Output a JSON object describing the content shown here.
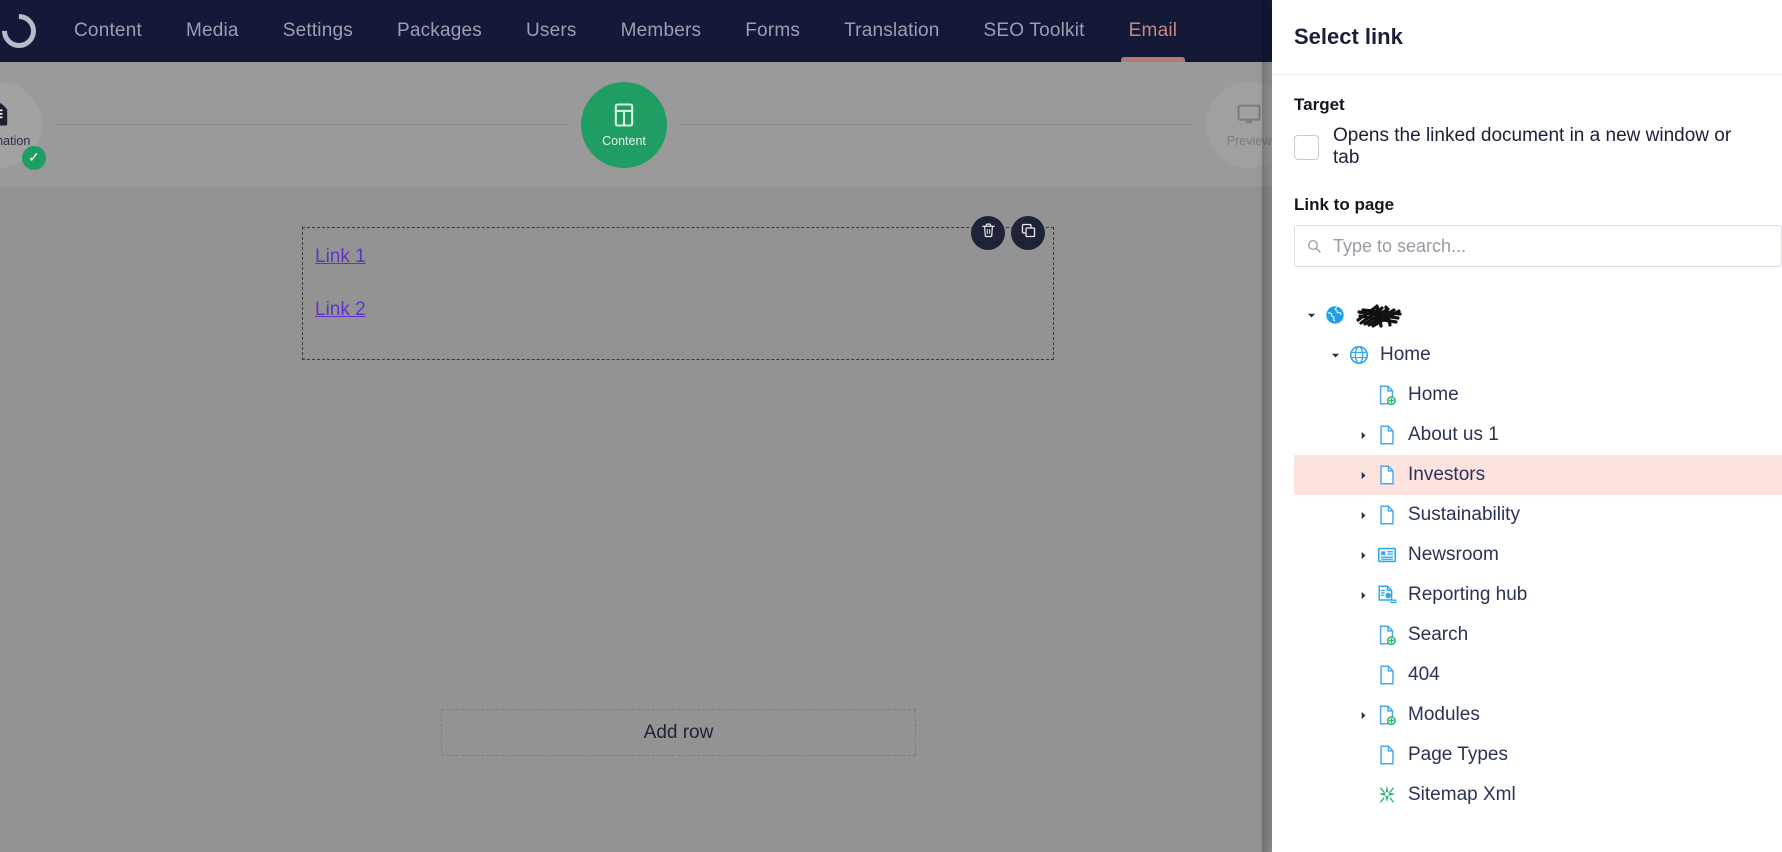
{
  "topnav": {
    "logo_name": "umbraco-logo",
    "items": [
      {
        "label": "Content",
        "active": false
      },
      {
        "label": "Media",
        "active": false
      },
      {
        "label": "Settings",
        "active": false
      },
      {
        "label": "Packages",
        "active": false
      },
      {
        "label": "Users",
        "active": false
      },
      {
        "label": "Members",
        "active": false
      },
      {
        "label": "Forms",
        "active": false
      },
      {
        "label": "Translation",
        "active": false
      },
      {
        "label": "SEO Toolkit",
        "active": false
      },
      {
        "label": "Email",
        "active": true
      }
    ],
    "bg_color": "#141938",
    "active_color": "#c7897f"
  },
  "stepper": {
    "steps": [
      {
        "label": "Information",
        "state": "complete",
        "icon": "document-icon",
        "check": "✓"
      },
      {
        "label": "Content",
        "state": "active",
        "icon": "layout-icon"
      },
      {
        "label": "Preview",
        "state": "muted",
        "icon": "monitor-icon"
      }
    ],
    "active_color": "#1f9d62"
  },
  "canvas": {
    "row_block": {
      "links": [
        "Link 1",
        "Link 2 "
      ],
      "link_color": "#6134c9",
      "actions": [
        {
          "name": "delete-row-button",
          "icon": "trash-icon"
        },
        {
          "name": "copy-row-button",
          "icon": "copy-icon"
        }
      ]
    },
    "add_row_label": "Add row"
  },
  "panel": {
    "title": "Select link",
    "target": {
      "label": "Target",
      "checkbox_label": "Opens the linked document in a new window or tab",
      "checked": false
    },
    "link_to_page": {
      "label": "Link to page",
      "search_placeholder": "Type to search...",
      "search_value": ""
    },
    "tree": {
      "highlight_color": "#fce3de",
      "nodes": [
        {
          "label": "",
          "redacted": true,
          "icon": "globe-icon",
          "depth": 0,
          "caret": "expanded",
          "highlight": false
        },
        {
          "label": "Home",
          "icon": "globe-outline-icon",
          "depth": 1,
          "caret": "expanded",
          "highlight": false
        },
        {
          "label": "Home",
          "icon": "document-add-icon",
          "depth": 2,
          "caret": "none",
          "highlight": false
        },
        {
          "label": "About us 1",
          "icon": "document-icon",
          "depth": 2,
          "caret": "collapsed",
          "highlight": false
        },
        {
          "label": "Investors",
          "icon": "document-icon",
          "depth": 2,
          "caret": "collapsed",
          "highlight": true
        },
        {
          "label": "Sustainability",
          "icon": "document-icon",
          "depth": 2,
          "caret": "collapsed",
          "highlight": false
        },
        {
          "label": "Newsroom",
          "icon": "newspaper-icon",
          "depth": 2,
          "caret": "collapsed",
          "highlight": false
        },
        {
          "label": "Reporting hub",
          "icon": "report-document-icon",
          "depth": 2,
          "caret": "collapsed",
          "highlight": false
        },
        {
          "label": "Search",
          "icon": "document-add-icon",
          "depth": 2,
          "caret": "none",
          "highlight": false
        },
        {
          "label": "404",
          "icon": "document-icon",
          "depth": 2,
          "caret": "none",
          "highlight": false
        },
        {
          "label": "Modules",
          "icon": "document-add-icon",
          "depth": 2,
          "caret": "collapsed",
          "highlight": false
        },
        {
          "label": "Page Types",
          "icon": "document-icon",
          "depth": 2,
          "caret": "none",
          "highlight": false
        },
        {
          "label": "Sitemap Xml",
          "icon": "sparkle-icon",
          "depth": 2,
          "caret": "none",
          "highlight": false
        }
      ]
    }
  }
}
